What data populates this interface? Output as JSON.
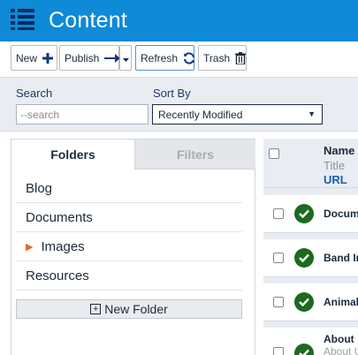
{
  "header": {
    "title": "Content",
    "menu_icon": "hamburger-list-icon"
  },
  "toolbar": {
    "new_label": "New",
    "publish_label": "Publish",
    "refresh_label": "Refresh",
    "trash_label": "Trash"
  },
  "filters": {
    "search_label": "Search",
    "search_placeholder": "--search",
    "sort_label": "Sort By",
    "sort_value": "Recently Modified"
  },
  "left_panel": {
    "tabs": [
      "Folders",
      "Filters"
    ],
    "folders": [
      {
        "label": "Blog",
        "expandable": false
      },
      {
        "label": "Documents",
        "expandable": false
      },
      {
        "label": "Images",
        "expandable": true
      },
      {
        "label": "Resources",
        "expandable": false
      }
    ],
    "new_folder_label": "New Folder"
  },
  "table": {
    "headers": {
      "name": "Name",
      "title": "Title",
      "url": "URL"
    },
    "rows": [
      {
        "title": "Docum",
        "subtitle": ""
      },
      {
        "title": "Band In",
        "subtitle": ""
      },
      {
        "title": "Animal",
        "subtitle": ""
      },
      {
        "title": "About",
        "subtitle": "About U"
      }
    ]
  },
  "colors": {
    "header_bg": "#0e8ad7",
    "status_ok": "#1c6a1f",
    "accent_orange": "#d96c27"
  }
}
